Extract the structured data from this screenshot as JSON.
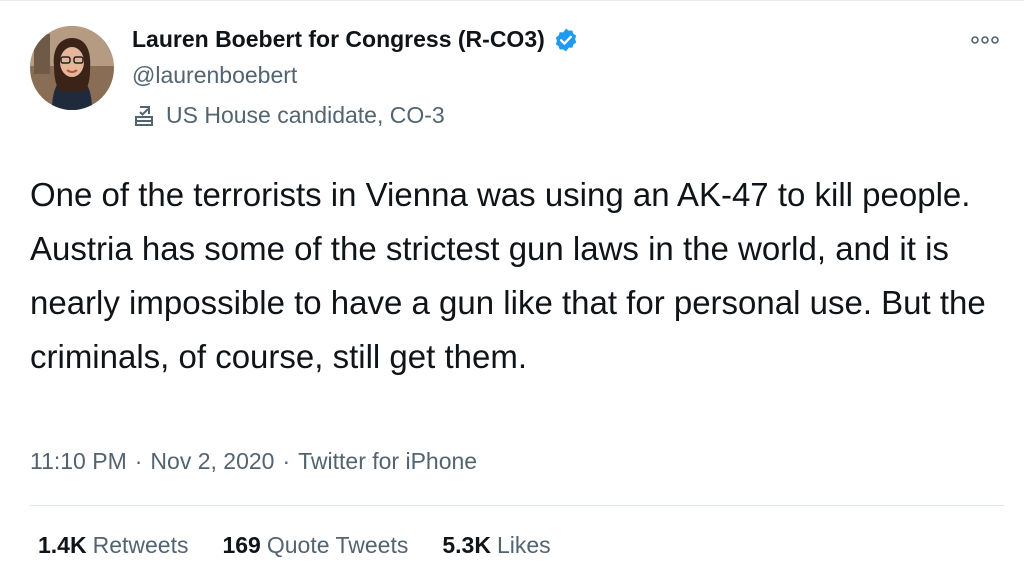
{
  "author": {
    "display_name": "Lauren Boebert for Congress (R-CO3)",
    "handle": "@laurenboebert",
    "label": "US House candidate, CO-3",
    "verified": true
  },
  "tweet": {
    "text": "One of the terrorists in Vienna was using an AK-47 to kill people. Austria has some of the strictest gun laws in the world, and it is nearly impossible to have a gun like that for personal use. But the criminals, of course, still get them.",
    "time": "11:10 PM",
    "date": "Nov 2, 2020",
    "separator": "·",
    "source": "Twitter for iPhone"
  },
  "stats": [
    {
      "count": "1.4K",
      "label": "Retweets"
    },
    {
      "count": "169",
      "label": "Quote Tweets"
    },
    {
      "count": "5.3K",
      "label": "Likes"
    }
  ],
  "icons": {
    "verified": "verified-badge-icon",
    "label": "ballot-box-icon",
    "more": "more-options-icon"
  },
  "colors": {
    "verified_blue": "#1d9bf0",
    "secondary_text": "#536471",
    "primary_text": "#0f1419"
  }
}
